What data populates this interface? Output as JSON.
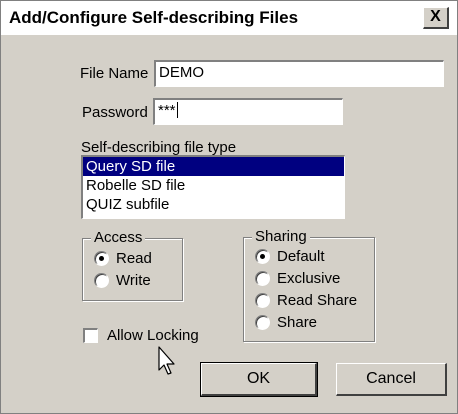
{
  "window": {
    "title": "Add/Configure Self-describing Files",
    "close_glyph": "X"
  },
  "file_name": {
    "label": "File Name",
    "value": "DEMO"
  },
  "password": {
    "label": "Password",
    "value": "***"
  },
  "file_type": {
    "label": "Self-describing file type",
    "items": [
      "Query SD file",
      "Robelle SD file",
      "QUIZ subfile"
    ],
    "selected": "Query SD file"
  },
  "access": {
    "title": "Access",
    "options": [
      {
        "label": "Read",
        "checked": true
      },
      {
        "label": "Write",
        "checked": false
      }
    ]
  },
  "sharing": {
    "title": "Sharing",
    "options": [
      {
        "label": "Default",
        "checked": true
      },
      {
        "label": "Exclusive",
        "checked": false
      },
      {
        "label": "Read Share",
        "checked": false
      },
      {
        "label": "Share",
        "checked": false
      }
    ]
  },
  "allow_locking": {
    "label": "Allow Locking",
    "checked": false
  },
  "buttons": {
    "ok": "OK",
    "cancel": "Cancel"
  },
  "icons": {
    "cursor": "arrow-cursor-icon"
  }
}
